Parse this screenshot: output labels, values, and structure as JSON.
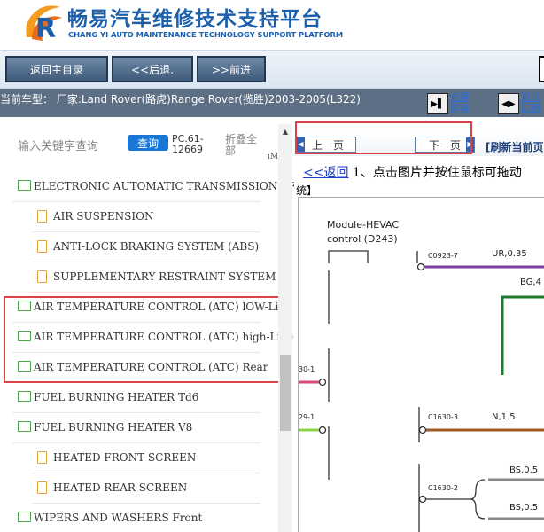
{
  "header": {
    "brand_cn": "畅易汽车维修技术支持平台",
    "brand_en": "CHANG YI AUTO MAINTENANCE TECHNOLOGY SUPPORT PLATFORM",
    "accent_color": "#1d5fab"
  },
  "toolbar": {
    "home_label": "返回主目录",
    "back_label": "<<后退.",
    "forward_label": ">>前进"
  },
  "infobar": {
    "vehicle_text": "当前车型： 厂家:Land Rover(路虎)Range Rover(揽胜)2003-2005(L322)",
    "fullscreen_label_1": "全屏",
    "fullscreen_label_2": "菜单",
    "default_view_label_1": "默认",
    "default_view_label_2": "视图"
  },
  "search": {
    "placeholder": "输入关键字查询",
    "button_label": "查询",
    "pc_code_1": "PC.61-",
    "pc_code_2": "12669",
    "collapse_1": "折叠全",
    "collapse_2": "部",
    "tiny_mark": "iM"
  },
  "tree": [
    {
      "type": "folder",
      "label": "ELECTRONIC AUTOMATIC TRANSMISSION ZF"
    },
    {
      "type": "doc",
      "label": "AIR SUSPENSION"
    },
    {
      "type": "doc",
      "label": "ANTI-LOCK BRAKING SYSTEM (ABS)"
    },
    {
      "type": "doc",
      "label": "SUPPLEMENTARY RESTRAINT SYSTEM"
    },
    {
      "type": "folder",
      "label": "AIR TEMPERATURE CONTROL (ATC) lOW-Line"
    },
    {
      "type": "folder",
      "label": "AIR TEMPERATURE CONTROL (ATC) high-Line"
    },
    {
      "type": "folder",
      "label": "AIR TEMPERATURE CONTROL (ATC) Rear"
    },
    {
      "type": "folder",
      "label": "FUEL BURNING HEATER Td6"
    },
    {
      "type": "folder",
      "label": "FUEL BURNING HEATER V8"
    },
    {
      "type": "doc",
      "label": "HEATED FRONT SCREEN"
    },
    {
      "type": "doc",
      "label": "HEATED REAR SCREEN"
    },
    {
      "type": "folder",
      "label": "WIPERS AND WASHERS Front"
    }
  ],
  "pager": {
    "prev_label": "上一页",
    "next_label": "下一页",
    "refresh_label": "[刷新当前页"
  },
  "content": {
    "return_link": "<<返回",
    "instruction": "1、点击图片并按住鼠标可拖动",
    "continuation": "统】"
  },
  "diagram": {
    "module_label_1": "Module-HEVAC",
    "module_label_2": "control (D243)",
    "c0923": "C0923-7",
    "ur": "UR,0.35",
    "bg": "BG,4",
    "c30": "30-1",
    "c29": "29-1",
    "c1630_3": "C1630-3",
    "n": "N,1.5",
    "c1630_2": "C1630-2",
    "bs1": "BS,0.5",
    "bs2": "BS,0.5"
  }
}
